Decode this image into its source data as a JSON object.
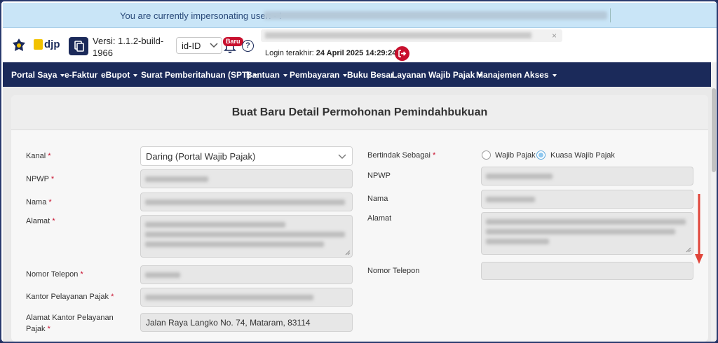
{
  "banner": {
    "text": "You are currently impersonating user: - !"
  },
  "header": {
    "version_label": "Versi:",
    "version_value": "1.1.2-build-1966",
    "language": "id-ID",
    "badge": "Baru",
    "help": "?",
    "login_label": "Login terakhir:",
    "login_value": "24 April 2025 14:29:24"
  },
  "nav": {
    "items": [
      {
        "label": "Portal Saya",
        "caret": true
      },
      {
        "label": "e-Faktur",
        "caret": false
      },
      {
        "label": "eBupot",
        "caret": true
      },
      {
        "label": "Surat Pemberitahuan (SPT)",
        "caret": true
      },
      {
        "label": "Bantuan",
        "caret": true
      },
      {
        "label": "Pembayaran",
        "caret": true
      },
      {
        "label": "Buku Besar",
        "caret": false
      },
      {
        "label": "Layanan Wajib Pajak",
        "caret": true
      },
      {
        "label": "Manajemen Akses",
        "caret": true
      }
    ]
  },
  "form": {
    "title": "Buat Baru Detail Permohonan Pemindahbukuan",
    "left": {
      "kanal_label": "Kanal",
      "kanal_value": "Daring (Portal Wajib Pajak)",
      "npwp_label": "NPWP",
      "nama_label": "Nama",
      "alamat_label": "Alamat",
      "telepon_label": "Nomor Telepon",
      "kpp_label": "Kantor Pelayanan Pajak",
      "alamat_kpp_label_1": "Alamat Kantor Pelayanan",
      "alamat_kpp_label_2": "Pajak",
      "alamat_kpp_value": "Jalan Raya Langko No. 74, Mataram, 83114"
    },
    "right": {
      "bertindak_label": "Bertindak Sebagai",
      "option_wp": "Wajib Pajak",
      "option_kuasa": "Kuasa Wajib Pajak",
      "selected": "Kuasa Wajib Pajak",
      "npwp_label": "NPWP",
      "nama_label": "Nama",
      "alamat_label": "Alamat",
      "telepon_label": "Nomor Telepon"
    },
    "required_mark": "*"
  },
  "colors": {
    "navy": "#1b2a5a",
    "banner": "#c9e5f7",
    "danger": "#c8102e",
    "annotation_arrow": "#e0453a"
  }
}
